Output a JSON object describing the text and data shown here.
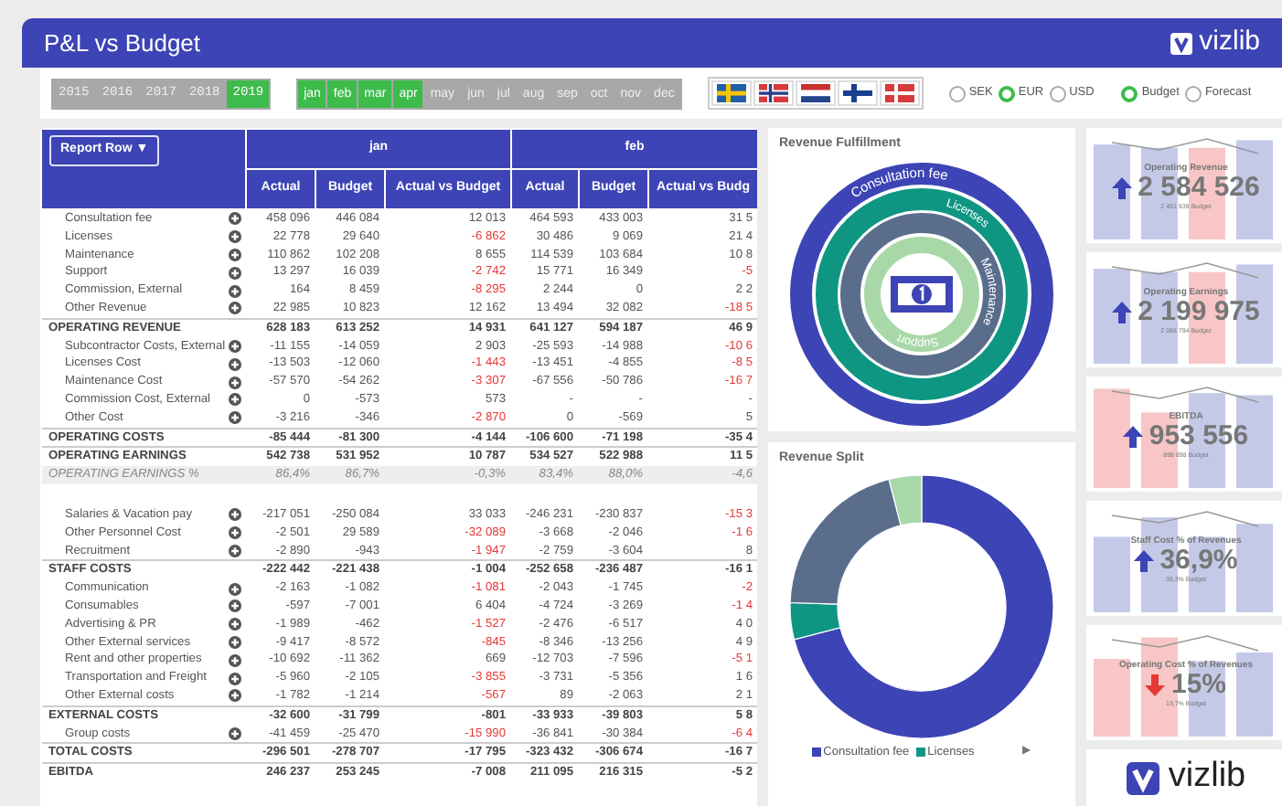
{
  "header": {
    "title": "P&L vs Budget",
    "logo": "vizlib"
  },
  "filters": {
    "years": [
      {
        "label": "2015",
        "selected": false
      },
      {
        "label": "2016",
        "selected": false
      },
      {
        "label": "2017",
        "selected": false
      },
      {
        "label": "2018",
        "selected": false
      },
      {
        "label": "2019",
        "selected": true
      }
    ],
    "months": [
      {
        "label": "jan",
        "selected": true
      },
      {
        "label": "feb",
        "selected": true
      },
      {
        "label": "mar",
        "selected": true
      },
      {
        "label": "apr",
        "selected": true
      },
      {
        "label": "may",
        "selected": false
      },
      {
        "label": "jun",
        "selected": false
      },
      {
        "label": "jul",
        "selected": false
      },
      {
        "label": "aug",
        "selected": false
      },
      {
        "label": "sep",
        "selected": false
      },
      {
        "label": "oct",
        "selected": false
      },
      {
        "label": "nov",
        "selected": false
      },
      {
        "label": "dec",
        "selected": false
      }
    ],
    "flags": [
      {
        "kind": "sweden"
      },
      {
        "kind": "norway"
      },
      {
        "kind": "netherlands"
      },
      {
        "kind": "finland"
      },
      {
        "kind": "denmark"
      }
    ],
    "currencies": [
      {
        "label": "SEK",
        "selected": false
      },
      {
        "label": "EUR",
        "selected": true
      },
      {
        "label": "USD",
        "selected": false
      }
    ],
    "scenarios": [
      {
        "label": "Budget",
        "selected": true
      },
      {
        "label": "Forecast",
        "selected": false
      }
    ]
  },
  "table": {
    "report_button": {
      "label": "Report Row",
      "caret": "▼"
    },
    "groups": [
      {
        "label": "jan",
        "columns": [
          "Actual",
          "Budget",
          "Actual vs Budget"
        ]
      },
      {
        "label": "feb",
        "columns": [
          "Actual",
          "Budget",
          "Actual vs Budg"
        ]
      }
    ],
    "rows": [
      {
        "kind": "item",
        "label": "Consultation fee",
        "cells": [
          "458 096",
          "446 084",
          "12 013",
          "464 593",
          "433 003",
          "31 5"
        ]
      },
      {
        "kind": "item",
        "label": "Licenses",
        "cells": [
          "22 778",
          "29 640",
          "-6 862",
          "30 486",
          "9 069",
          "21 4"
        ]
      },
      {
        "kind": "item",
        "label": "Maintenance",
        "cells": [
          "110 862",
          "102 208",
          "8 655",
          "114 539",
          "103 684",
          "10 8"
        ]
      },
      {
        "kind": "item",
        "label": "Support",
        "cells": [
          "13 297",
          "16 039",
          "-2 742",
          "15 771",
          "16 349",
          "-5"
        ]
      },
      {
        "kind": "item",
        "label": "Commission, External",
        "cells": [
          "164",
          "8 459",
          "-8 295",
          "2 244",
          "0",
          "2 2"
        ]
      },
      {
        "kind": "item",
        "label": "Other Revenue",
        "cells": [
          "22 985",
          "10 823",
          "12 162",
          "13 494",
          "32 082",
          "-18 5"
        ]
      },
      {
        "kind": "total",
        "label": "OPERATING REVENUE",
        "cells": [
          "628 183",
          "613 252",
          "14 931",
          "641 127",
          "594 187",
          "46 9"
        ]
      },
      {
        "kind": "item",
        "label": "Subcontractor Costs, External",
        "cells": [
          "-11 155",
          "-14 059",
          "2 903",
          "-25 593",
          "-14 988",
          "-10 6"
        ]
      },
      {
        "kind": "item",
        "label": "Licenses Cost",
        "cells": [
          "-13 503",
          "-12 060",
          "-1 443",
          "-13 451",
          "-4 855",
          "-8 5"
        ]
      },
      {
        "kind": "item",
        "label": "Maintenance Cost",
        "cells": [
          "-57 570",
          "-54 262",
          "-3 307",
          "-67 556",
          "-50 786",
          "-16 7"
        ]
      },
      {
        "kind": "item",
        "label": "Commission Cost, External",
        "cells": [
          "0",
          "-573",
          "573",
          "-",
          "-",
          "-"
        ]
      },
      {
        "kind": "item",
        "label": "Other Cost",
        "cells": [
          "-3 216",
          "-346",
          "-2 870",
          "0",
          "-569",
          "5"
        ]
      },
      {
        "kind": "total",
        "label": "OPERATING COSTS",
        "cells": [
          "-85 444",
          "-81 300",
          "-4 144",
          "-106 600",
          "-71 198",
          "-35 4"
        ]
      },
      {
        "kind": "total",
        "label": "OPERATING EARNINGS",
        "cells": [
          "542 738",
          "531 952",
          "10 787",
          "534 527",
          "522 988",
          "11 5"
        ]
      },
      {
        "kind": "percent",
        "label": "OPERATING EARNINGS %",
        "cells": [
          "86,4%",
          "86,7%",
          "-0,3%",
          "83,4%",
          "88,0%",
          "-4,6"
        ]
      },
      {
        "kind": "spacer"
      },
      {
        "kind": "item",
        "label": "Salaries & Vacation pay",
        "cells": [
          "-217 051",
          "-250 084",
          "33 033",
          "-246 231",
          "-230 837",
          "-15 3"
        ]
      },
      {
        "kind": "item",
        "label": "Other Personnel Cost",
        "cells": [
          "-2 501",
          "29 589",
          "-32 089",
          "-3 668",
          "-2 046",
          "-1 6"
        ]
      },
      {
        "kind": "item",
        "label": "Recruitment",
        "cells": [
          "-2 890",
          "-943",
          "-1 947",
          "-2 759",
          "-3 604",
          "8"
        ]
      },
      {
        "kind": "total",
        "label": "STAFF COSTS",
        "cells": [
          "-222 442",
          "-221 438",
          "-1 004",
          "-252 658",
          "-236 487",
          "-16 1"
        ]
      },
      {
        "kind": "item",
        "label": "Communication",
        "cells": [
          "-2 163",
          "-1 082",
          "-1 081",
          "-2 043",
          "-1 745",
          "-2"
        ]
      },
      {
        "kind": "item",
        "label": "Consumables",
        "cells": [
          "-597",
          "-7 001",
          "6 404",
          "-4 724",
          "-3 269",
          "-1 4"
        ]
      },
      {
        "kind": "item",
        "label": "Advertising & PR",
        "cells": [
          "-1 989",
          "-462",
          "-1 527",
          "-2 476",
          "-6 517",
          "4 0"
        ]
      },
      {
        "kind": "item",
        "label": "Other External services",
        "cells": [
          "-9 417",
          "-8 572",
          "-845",
          "-8 346",
          "-13 256",
          "4 9"
        ]
      },
      {
        "kind": "item",
        "label": "Rent and other properties",
        "cells": [
          "-10 692",
          "-11 362",
          "669",
          "-12 703",
          "-7 596",
          "-5 1"
        ]
      },
      {
        "kind": "item",
        "label": "Transportation and Freight",
        "cells": [
          "-5 960",
          "-2 105",
          "-3 855",
          "-3 731",
          "-5 356",
          "1 6"
        ]
      },
      {
        "kind": "item",
        "label": "Other External costs",
        "cells": [
          "-1 782",
          "-1 214",
          "-567",
          "89",
          "-2 063",
          "2 1"
        ]
      },
      {
        "kind": "total",
        "label": "EXTERNAL COSTS",
        "cells": [
          "-32 600",
          "-31 799",
          "-801",
          "-33 933",
          "-39 803",
          "5 8"
        ]
      },
      {
        "kind": "item",
        "label": "Group costs",
        "cells": [
          "-41 459",
          "-25 470",
          "-15 990",
          "-36 841",
          "-30 384",
          "-6 4"
        ]
      },
      {
        "kind": "total",
        "label": "TOTAL COSTS",
        "cells": [
          "-296 501",
          "-278 707",
          "-17 795",
          "-323 432",
          "-306 674",
          "-16 7"
        ]
      },
      {
        "kind": "total",
        "label": "EBITDA",
        "cells": [
          "246 237",
          "253 245",
          "-7 008",
          "211 095",
          "216 315",
          "-5 2"
        ]
      }
    ]
  },
  "revenue_fulfillment": {
    "title": "Revenue Fulfillment",
    "rings": [
      {
        "label": "Consultation fee",
        "color": "#3d44b5"
      },
      {
        "label": "Licenses",
        "color": "#0f9682"
      },
      {
        "label": "Maintenance",
        "color": "#5a6e8c"
      },
      {
        "label": "Support",
        "color": "#a8d8a8"
      }
    ]
  },
  "revenue_split": {
    "title": "Revenue Split",
    "segments": [
      {
        "color": "#3d44b5"
      },
      {
        "color": "#0f9682"
      },
      {
        "color": "#5a6e8c"
      },
      {
        "color": "#a8d8a8"
      }
    ],
    "legend": [
      {
        "label": "Consultation fee",
        "color": "#3d44b5"
      },
      {
        "label": "Licenses",
        "color": "#0f9682"
      }
    ],
    "more": "▶"
  },
  "kpis": [
    {
      "title": "Operating Revenue",
      "value": "2 584 526",
      "budget": "2 451 939 Budget",
      "kind": "up",
      "bars": [
        {
          "color": "#c5c9e8"
        },
        {
          "color": "#c5c9e8"
        },
        {
          "color": "#f8c6c6"
        },
        {
          "color": "#c5c9e8"
        }
      ]
    },
    {
      "title": "Operating Earnings",
      "value": "2 199 975",
      "budget": "2 088 794 Budget",
      "kind": "up",
      "bars": [
        {
          "color": "#c5c9e8"
        },
        {
          "color": "#c5c9e8"
        },
        {
          "color": "#f8c6c6"
        },
        {
          "color": "#c5c9e8"
        }
      ]
    },
    {
      "title": "EBITDA",
      "value": "953 556",
      "budget": "898 898 Budget",
      "kind": "up",
      "bars": [
        {
          "color": "#f8c6c6"
        },
        {
          "color": "#f8c6c6"
        },
        {
          "color": "#c5c9e8"
        },
        {
          "color": "#c5c9e8"
        }
      ]
    },
    {
      "title": "Staff Cost % of Revenues",
      "value": "36,9%",
      "budget": "38,3% Budget",
      "kind": "up",
      "bars": [
        {
          "color": "#c5c9e8"
        },
        {
          "color": "#c5c9e8"
        },
        {
          "color": "#c5c9e8"
        },
        {
          "color": "#c5c9e8"
        }
      ]
    },
    {
      "title": "Operating Cost % of Revenues",
      "value": "15%",
      "budget": "13,7% Budget",
      "kind": "down",
      "bars": [
        {
          "color": "#f8c6c6"
        },
        {
          "color": "#f8c6c6"
        },
        {
          "color": "#c5c9e8"
        },
        {
          "color": "#c5c9e8"
        }
      ]
    }
  ],
  "footer_logo": "vizlib"
}
